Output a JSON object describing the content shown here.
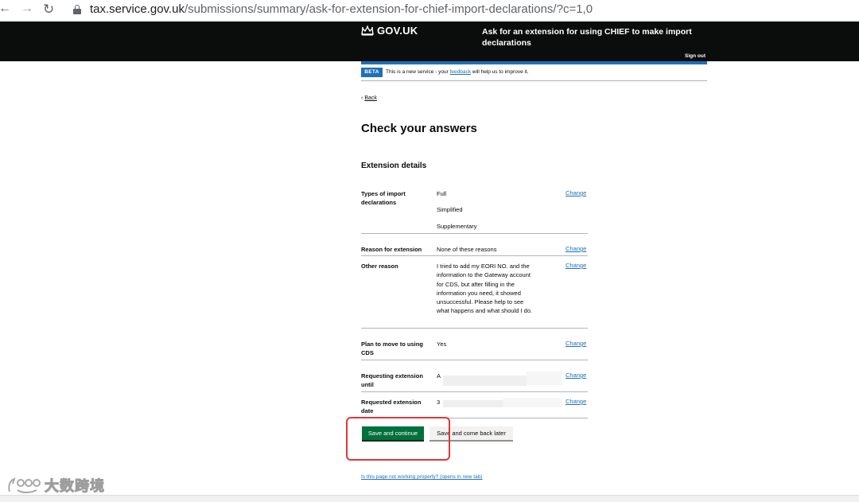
{
  "browser": {
    "back_glyph": "←",
    "forward_glyph": "→",
    "reload_glyph": "↻",
    "url_host": "tax.service.gov.uk",
    "url_path": "/submissions/summary/ask-for-extension-for-chief-import-declarations/?c=1,0"
  },
  "header": {
    "logo_text": "GOV.UK",
    "service_name": "Ask for an extension for using CHIEF to make import declarations",
    "sign_out": "Sign out"
  },
  "phase_banner": {
    "tag": "BETA",
    "text_before": "This is a new service - your ",
    "feedback_link": "feedback",
    "text_after": " will help us to improve it."
  },
  "back_link": "Back",
  "page_title": "Check your answers",
  "section_title": "Extension details",
  "change_label": "Change",
  "summary": {
    "types": {
      "key": "Types of import declarations",
      "values": [
        "Full",
        "Simplified",
        "Supplementary"
      ]
    },
    "reason": {
      "key": "Reason for extension",
      "value": "None of these reasons"
    },
    "other_reason": {
      "key": "Other reason",
      "value": "I tried to add my EORI NO. and the information to the Gateway account for CDS, but after filling in the information you need, it showed unsuccessful. Please help to see what happens and what should I do."
    },
    "plan": {
      "key": "Plan to move to using CDS",
      "value": "Yes"
    },
    "requesting_until": {
      "key": "Requesting extension until",
      "value": "A"
    },
    "requested_date": {
      "key": "Requested extension date",
      "value": "3"
    }
  },
  "buttons": {
    "save_continue": "Save and continue",
    "save_later": "Save and come back later"
  },
  "help_link": "Is this page not working properly? (opens in new tab)",
  "watermark_text": "大数跨境",
  "colors": {
    "header_black": "#0b0c0c",
    "govuk_blue": "#1d70b8",
    "button_green": "#00703c",
    "highlight_red": "#e0373a"
  }
}
